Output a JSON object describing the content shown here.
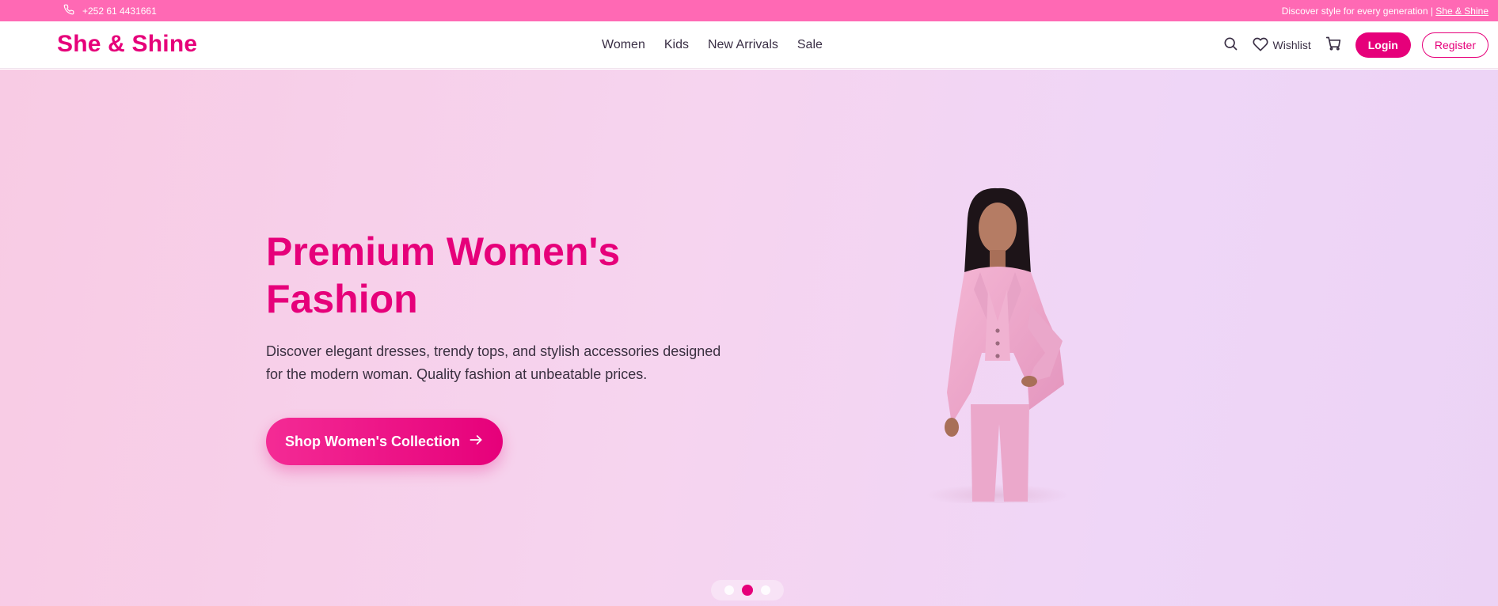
{
  "topbar": {
    "phone": "+252 61 4431661",
    "tagline": "Discover style for every generation | ",
    "brand_link": "She & Shine"
  },
  "header": {
    "logo": "She & Shine",
    "nav": [
      "Women",
      "Kids",
      "New Arrivals",
      "Sale"
    ],
    "wishlist_label": "Wishlist",
    "login_label": "Login",
    "register_label": "Register"
  },
  "hero": {
    "title": "Premium Women's Fashion",
    "description": "Discover elegant dresses, trendy tops, and stylish accessories designed for the modern woman. Quality fashion at unbeatable prices.",
    "cta_label": "Shop Women's Collection",
    "carousel": {
      "count": 3,
      "active_index": 1
    }
  },
  "colors": {
    "brand_pink": "#e6007a",
    "topbar_pink": "#ff69b4",
    "text_dark": "#3a2f45"
  },
  "icons": {
    "phone": "phone-icon",
    "search": "search-icon",
    "heart": "heart-icon",
    "cart": "cart-icon",
    "arrow": "arrow-right-icon"
  }
}
